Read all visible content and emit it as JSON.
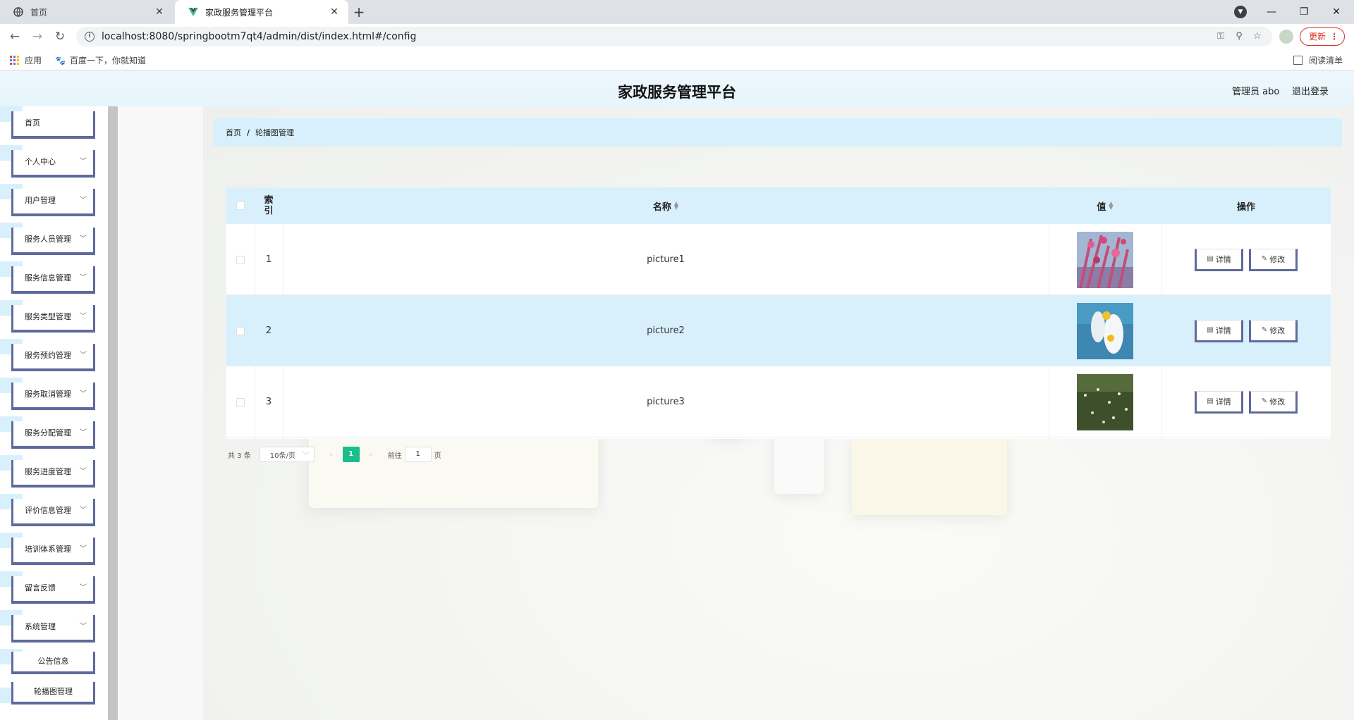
{
  "browser": {
    "tabs": [
      {
        "title": "首页",
        "active": false
      },
      {
        "title": "家政服务管理平台",
        "active": true
      }
    ],
    "url": "localhost:8080/springbootm7qt4/admin/dist/index.html#/config",
    "update_label": "更新",
    "bookmarks": [
      "应用",
      "百度一下，你就知道"
    ],
    "reading_list": "阅读清单"
  },
  "app": {
    "title": "家政服务管理平台",
    "admin": "管理员 abo",
    "logout": "退出登录"
  },
  "sidebar": {
    "items": [
      {
        "label": "首页",
        "expandable": false
      },
      {
        "label": "个人中心",
        "expandable": true
      },
      {
        "label": "用户管理",
        "expandable": true
      },
      {
        "label": "服务人员管理",
        "expandable": true
      },
      {
        "label": "服务信息管理",
        "expandable": true
      },
      {
        "label": "服务类型管理",
        "expandable": true
      },
      {
        "label": "服务预约管理",
        "expandable": true
      },
      {
        "label": "服务取消管理",
        "expandable": true
      },
      {
        "label": "服务分配管理",
        "expandable": true
      },
      {
        "label": "服务进度管理",
        "expandable": true
      },
      {
        "label": "评价信息管理",
        "expandable": true
      },
      {
        "label": "培训体系管理",
        "expandable": true
      },
      {
        "label": "留言反馈",
        "expandable": true
      },
      {
        "label": "系统管理",
        "expandable": true
      }
    ],
    "subitems": [
      "公告信息",
      "轮播图管理"
    ]
  },
  "breadcrumb": {
    "home": "首页",
    "separator": "/",
    "current": "轮播图管理"
  },
  "table": {
    "columns": {
      "index": "索引",
      "name": "名称",
      "value": "值",
      "actions": "操作"
    },
    "rows": [
      {
        "index": "1",
        "name": "picture1",
        "image": "pink-flowers"
      },
      {
        "index": "2",
        "name": "picture2",
        "image": "daisy-blue"
      },
      {
        "index": "3",
        "name": "picture3",
        "image": "green-foliage"
      }
    ],
    "detail_label": "详情",
    "edit_label": "修改"
  },
  "pagination": {
    "total": "共 3 条",
    "page_size": "10条/页",
    "current_page": "1",
    "goto_prefix": "前往",
    "goto_value": "1",
    "goto_suffix": "页"
  },
  "colors": {
    "accent": "#5f6a9c",
    "header_bg": "#d8f0fb",
    "pager_active": "#19be8c",
    "update_red": "#d93025"
  }
}
